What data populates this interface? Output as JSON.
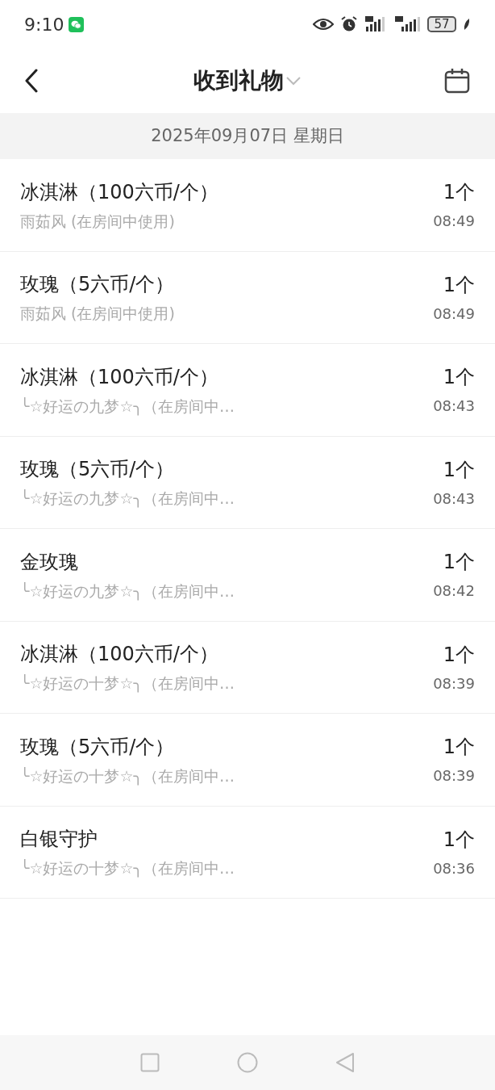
{
  "status_bar": {
    "time": "9:10",
    "battery": "57"
  },
  "header": {
    "title": "收到礼物"
  },
  "date_bar": {
    "date": "2025年09月07日 星期日"
  },
  "gifts": [
    {
      "name": "冰淇淋（100六币/个）",
      "sender": "雨茹风 (在房间中使用)",
      "count": "1个",
      "time": "08:49"
    },
    {
      "name": "玫瑰（5六币/个）",
      "sender": "雨茹风 (在房间中使用)",
      "count": "1个",
      "time": "08:49"
    },
    {
      "name": "冰淇淋（100六币/个）",
      "sender": "╰☆好运の九梦☆╮（在房间中…",
      "count": "1个",
      "time": "08:43"
    },
    {
      "name": "玫瑰（5六币/个）",
      "sender": "╰☆好运の九梦☆╮（在房间中…",
      "count": "1个",
      "time": "08:43"
    },
    {
      "name": "金玫瑰",
      "sender": "╰☆好运の九梦☆╮（在房间中…",
      "count": "1个",
      "time": "08:42"
    },
    {
      "name": "冰淇淋（100六币/个）",
      "sender": "╰☆好运の十梦☆╮（在房间中…",
      "count": "1个",
      "time": "08:39"
    },
    {
      "name": "玫瑰（5六币/个）",
      "sender": "╰☆好运の十梦☆╮（在房间中…",
      "count": "1个",
      "time": "08:39"
    },
    {
      "name": "白银守护",
      "sender": "╰☆好运の十梦☆╮（在房间中…",
      "count": "1个",
      "time": "08:36"
    }
  ]
}
